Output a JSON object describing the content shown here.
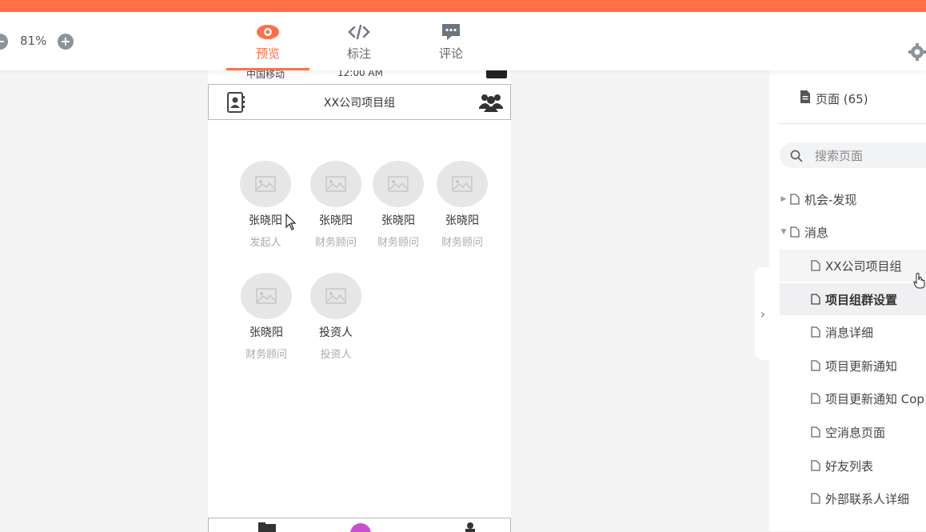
{
  "toolbar": {
    "zoom_level": "81%",
    "tabs": [
      {
        "label": "预览",
        "icon": "eye-icon",
        "active": true
      },
      {
        "label": "标注",
        "icon": "code-icon",
        "active": false
      },
      {
        "label": "评论",
        "icon": "comment-icon",
        "active": false
      }
    ],
    "accent_color": "#ff7047"
  },
  "phone": {
    "status_bar": {
      "carrier": "中国移动",
      "time": "12:00 AM"
    },
    "nav_title": "XX公司项目组",
    "members": [
      {
        "name": "张晓阳",
        "role": "发起人"
      },
      {
        "name": "张晓阳",
        "role": "财务顾问"
      },
      {
        "name": "张晓阳",
        "role": "财务顾问"
      },
      {
        "name": "张晓阳",
        "role": "财务顾问"
      },
      {
        "name": "张晓阳",
        "role": "财务顾问"
      },
      {
        "name": "投资人",
        "role": "投资人"
      }
    ]
  },
  "sidebar": {
    "pages_label": "页面 (65)",
    "search_placeholder": "搜索页面",
    "tree": [
      {
        "label": "机会-发现",
        "level": 0,
        "expanded": false
      },
      {
        "label": "消息",
        "level": 0,
        "expanded": true
      },
      {
        "label": "XX公司项目组",
        "level": 1
      },
      {
        "label": "项目组群设置",
        "level": 1,
        "selected": true
      },
      {
        "label": "消息详细",
        "level": 1
      },
      {
        "label": "项目更新通知",
        "level": 1
      },
      {
        "label": "项目更新通知 Cop",
        "level": 1
      },
      {
        "label": "空消息页面",
        "level": 1
      },
      {
        "label": "好友列表",
        "level": 1
      },
      {
        "label": "外部联系人详细",
        "level": 1
      }
    ]
  }
}
